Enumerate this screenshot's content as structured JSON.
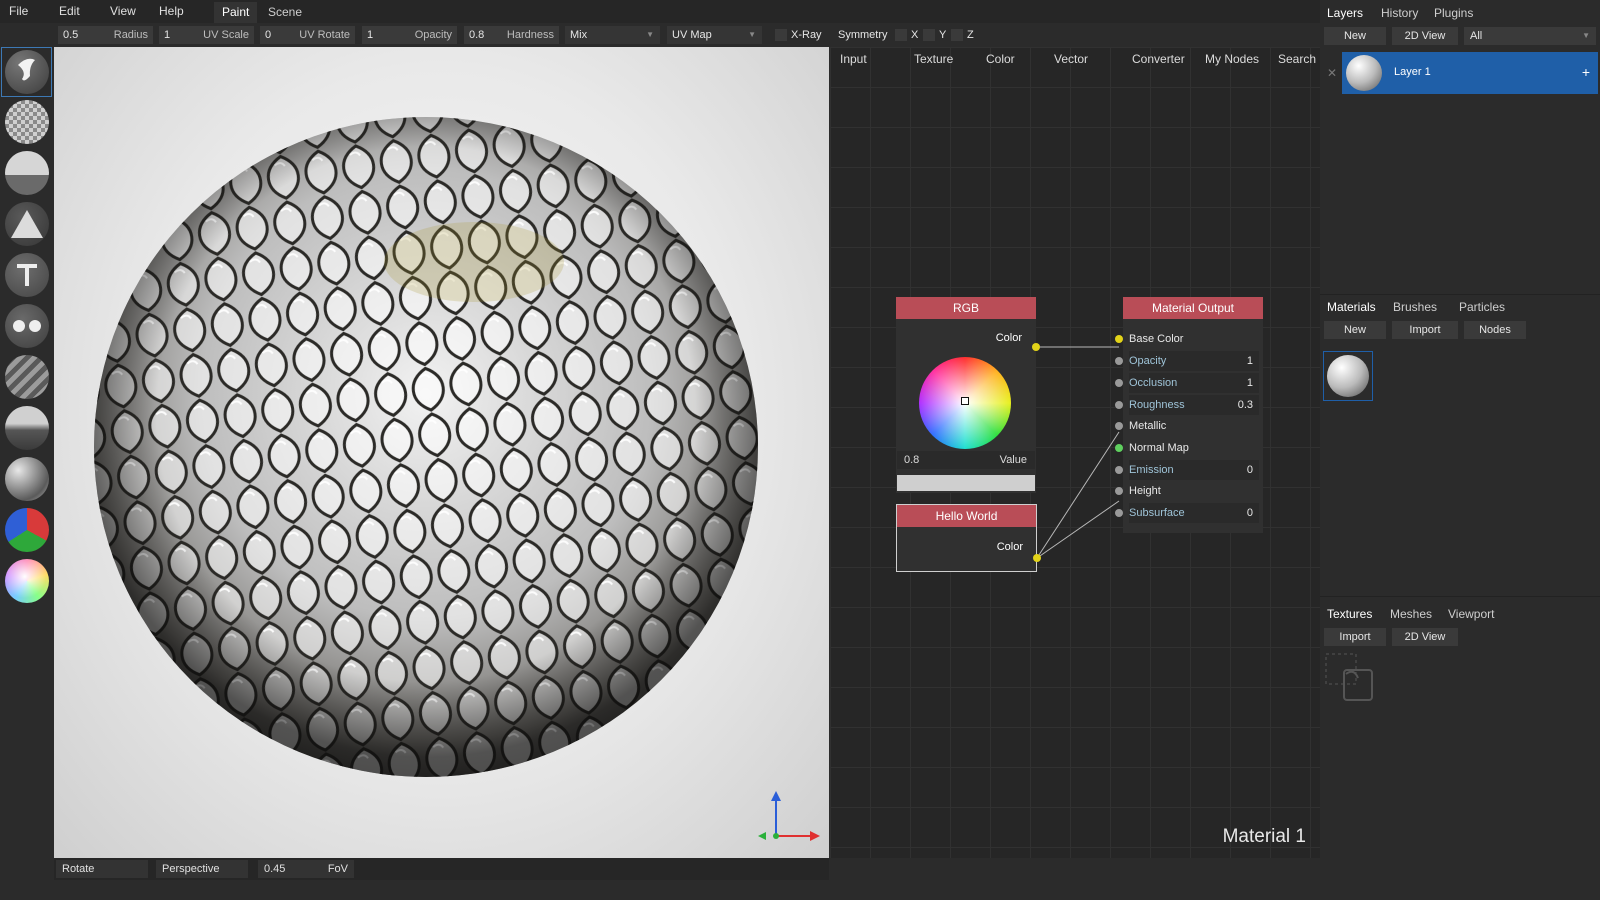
{
  "menu": {
    "items": [
      "File",
      "Edit",
      "View",
      "Help"
    ]
  },
  "workspace_tabs": [
    "Paint",
    "Scene"
  ],
  "toolbar": {
    "radius": {
      "value": "0.5",
      "label": "Radius"
    },
    "uv_scale": {
      "value": "1",
      "label": "UV Scale"
    },
    "uv_rotate": {
      "value": "0",
      "label": "UV Rotate"
    },
    "opacity": {
      "value": "1",
      "label": "Opacity"
    },
    "hardness": {
      "value": "0.8",
      "label": "Hardness"
    },
    "blend": "Mix",
    "mapping": "UV Map",
    "xray": "X-Ray",
    "symmetry": "Symmetry",
    "sym_x": "X",
    "sym_y": "Y",
    "sym_z": "Z"
  },
  "tools": [
    "brush-icon",
    "eraser-icon",
    "fill-icon",
    "decal-icon",
    "text-icon",
    "clone-icon",
    "blur-icon",
    "particle-icon",
    "bake-icon",
    "colorid-icon",
    "picker-icon"
  ],
  "viewport": {
    "colors": {
      "sphere_light": "#f4f4f4",
      "sphere_dark": "#2f2e2c",
      "gold": "#a8962f"
    }
  },
  "statusbar": {
    "camera_mode": "Rotate",
    "projection": "Perspective",
    "fov_value": "0.45",
    "fov_label": "FoV"
  },
  "node_categories": [
    "Input",
    "Texture",
    "Color",
    "Vector",
    "Converter",
    "My Nodes",
    "Search"
  ],
  "nodes": {
    "rgb": {
      "title": "RGB",
      "output": "Color",
      "value": "0.8",
      "value_label": "Value"
    },
    "hello": {
      "title": "Hello World",
      "output": "Color"
    },
    "material": {
      "title": "Material Output",
      "inputs": [
        {
          "label": "Base Color",
          "value": ""
        },
        {
          "label": "Opacity",
          "value": "1"
        },
        {
          "label": "Occlusion",
          "value": "1"
        },
        {
          "label": "Roughness",
          "value": "0.3"
        },
        {
          "label": "Metallic",
          "value": ""
        },
        {
          "label": "Normal Map",
          "value": ""
        },
        {
          "label": "Emission",
          "value": "0"
        },
        {
          "label": "Height",
          "value": ""
        },
        {
          "label": "Subsurface",
          "value": "0"
        }
      ]
    }
  },
  "canvas_name": "Material 1",
  "right": {
    "layers_tabs": [
      "Layers",
      "History",
      "Plugins"
    ],
    "layers_buttons": {
      "new": "New",
      "view2d": "2D View"
    },
    "layers_filter": "All",
    "layer_name": "Layer 1",
    "materials_tabs": [
      "Materials",
      "Brushes",
      "Particles"
    ],
    "materials_buttons": {
      "new": "New",
      "import": "Import",
      "nodes": "Nodes"
    },
    "textures_tabs": [
      "Textures",
      "Meshes",
      "Viewport"
    ],
    "textures_buttons": {
      "import": "Import",
      "view2d": "2D View"
    }
  },
  "colors": {
    "accent": "#1f5fa8",
    "node_header": "#b94d57",
    "socket_yellow": "#e2d319",
    "socket_green": "#5fd05f",
    "socket_grey": "#9a9a9a"
  }
}
